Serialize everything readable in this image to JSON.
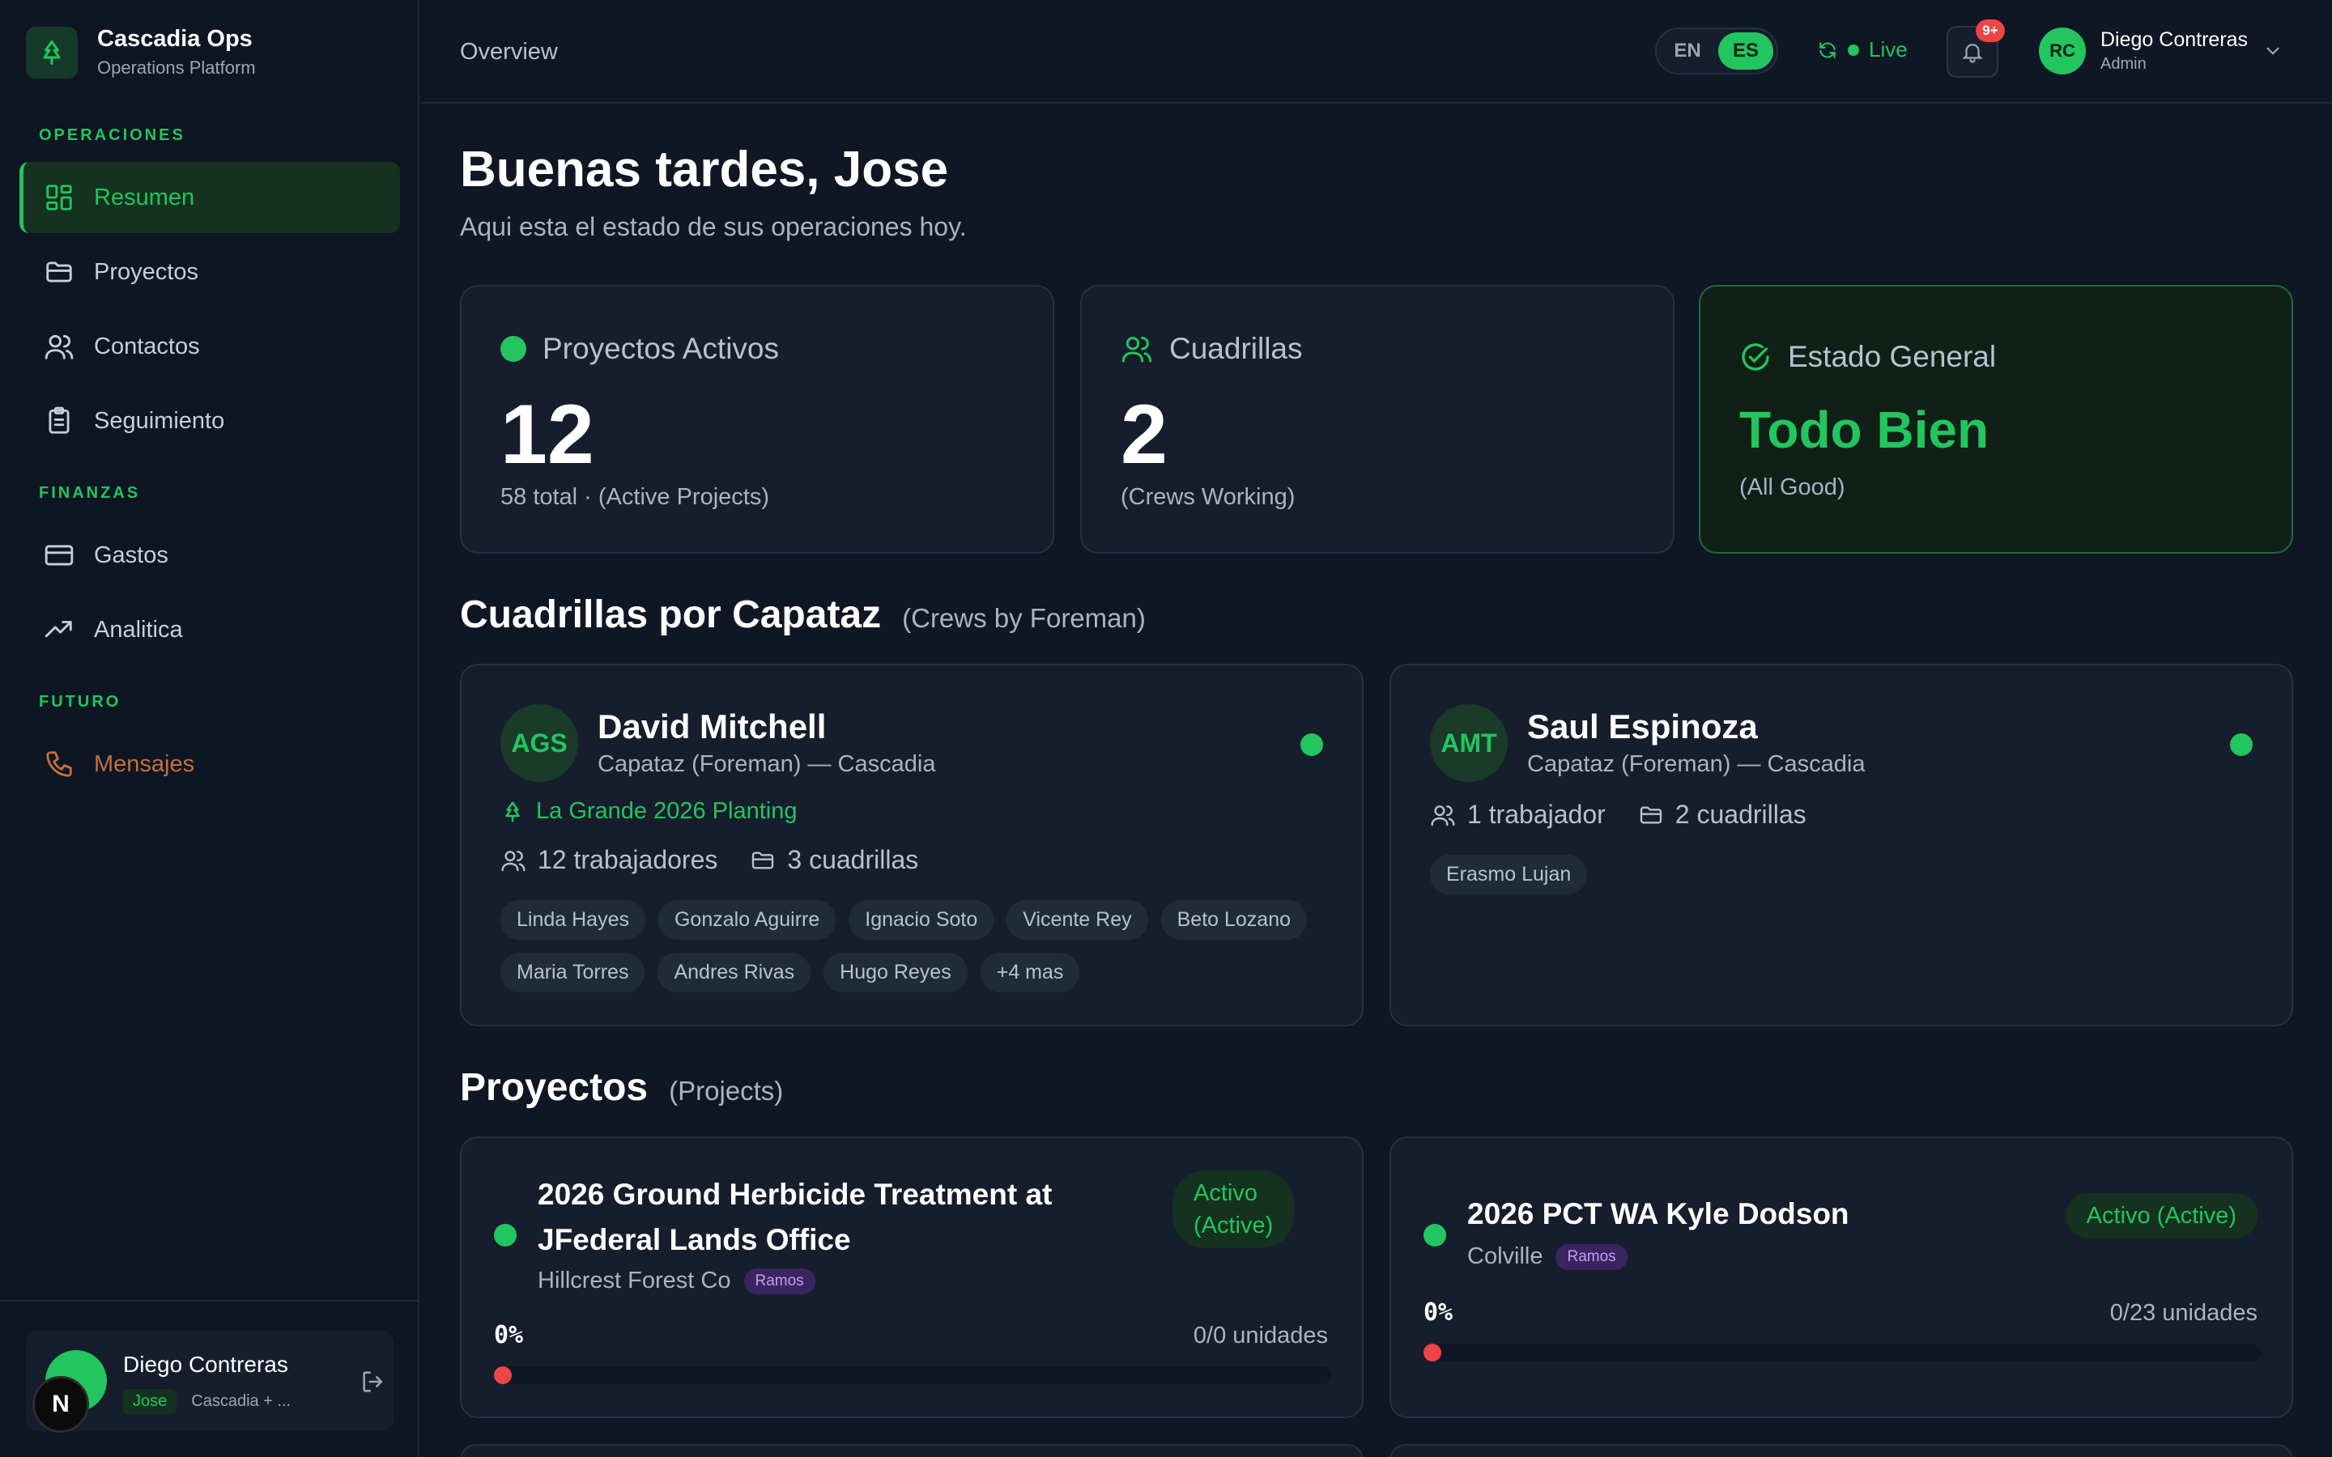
{
  "app": {
    "name": "Cascadia Ops",
    "subtitle": "Operations Platform"
  },
  "nav": {
    "sections": [
      "OPERACIONES",
      "FINANZAS",
      "FUTURO"
    ],
    "items": [
      {
        "label": "Resumen",
        "icon": "dashboard-icon",
        "active": true
      },
      {
        "label": "Proyectos",
        "icon": "folder-icon"
      },
      {
        "label": "Contactos",
        "icon": "users-icon"
      },
      {
        "label": "Seguimiento",
        "icon": "clipboard-icon"
      },
      {
        "label": "Gastos",
        "icon": "credit-card-icon"
      },
      {
        "label": "Analitica",
        "icon": "trending-up-icon"
      },
      {
        "label": "Mensajes",
        "icon": "phone-icon"
      }
    ]
  },
  "sidebar_user": {
    "name": "Diego Contreras",
    "badge": "Jose",
    "org": "Cascadia + ...",
    "overlay_letter": "N"
  },
  "header": {
    "breadcrumb": "Overview",
    "lang": {
      "en": "EN",
      "es": "ES",
      "selected": "ES"
    },
    "live_label": "Live",
    "notifications": "9+",
    "user": {
      "initials": "RC",
      "name": "Diego Contreras",
      "role": "Admin"
    }
  },
  "greeting": {
    "title": "Buenas tardes, Jose",
    "subtitle": "Aqui esta el estado de sus operaciones hoy."
  },
  "stats": [
    {
      "label": "Proyectos Activos",
      "value": "12",
      "sub": "58 total · (Active Projects)"
    },
    {
      "label": "Cuadrillas",
      "value": "2",
      "sub": "(Crews Working)"
    },
    {
      "label": "Estado General",
      "value": "Todo Bien",
      "sub": "(All Good)"
    }
  ],
  "crews_section": {
    "title": "Cuadrillas por Capataz",
    "subtitle": "(Crews by Foreman)"
  },
  "crews": [
    {
      "initials": "AGS",
      "name": "David Mitchell",
      "role": "Capataz (Foreman) — Cascadia",
      "project": "La Grande 2026 Planting",
      "workers": "12 trabajadores",
      "crews": "3 cuadrillas",
      "members": [
        "Linda Hayes",
        "Gonzalo Aguirre",
        "Ignacio Soto",
        "Vicente Rey",
        "Beto Lozano",
        "Maria Torres",
        "Andres Rivas",
        "Hugo Reyes",
        "+4 mas"
      ]
    },
    {
      "initials": "AMT",
      "name": "Saul Espinoza",
      "role": "Capataz (Foreman) — Cascadia",
      "workers": "1 trabajador",
      "crews": "2 cuadrillas",
      "members": [
        "Erasmo Lujan"
      ]
    }
  ],
  "projects_section": {
    "title": "Proyectos",
    "subtitle": "(Projects)"
  },
  "projects": [
    {
      "title_line1": "2026 Ground Herbicide Treatment at",
      "title_line2": "JFederal Lands Office",
      "client": "Hillcrest Forest Co",
      "tag": "Ramos",
      "status_line1": "Activo",
      "status_line2": "(Active)",
      "progress_label": "0%",
      "progress": 0,
      "units": "0/0 unidades"
    },
    {
      "title": "2026 PCT WA Kyle Dodson",
      "client": "Colville",
      "tag": "Ramos",
      "status": "Activo (Active)",
      "progress_label": "0%",
      "progress": 0,
      "units": "0/23 unidades"
    }
  ],
  "colors": {
    "accent": "#22c55e",
    "danger": "#ef4444",
    "background": "#0f1624",
    "card": "#161e2d",
    "future": "#c2703a"
  }
}
